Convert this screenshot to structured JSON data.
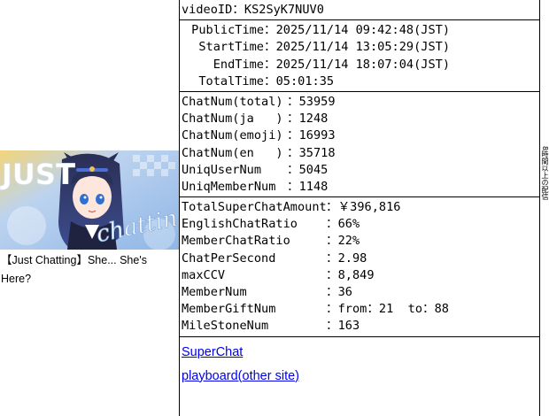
{
  "video_id": {
    "label": "videoID",
    "value": "KS2SyK7NUV0"
  },
  "times": [
    {
      "label": "PublicTime",
      "value": "2025/11/14 09:42:48(JST)"
    },
    {
      "label": "StartTime",
      "value": "2025/11/14 13:05:29(JST)"
    },
    {
      "label": "EndTime",
      "value": "2025/11/14 18:07:04(JST)"
    },
    {
      "label": "TotalTime",
      "value": "05:01:35"
    }
  ],
  "chat_counts": [
    {
      "label": "ChatNum(total)",
      "value": "53959"
    },
    {
      "label": "ChatNum(ja   )",
      "value": "1248"
    },
    {
      "label": "ChatNum(emoji)",
      "value": "16993"
    },
    {
      "label": "ChatNum(en   )",
      "value": "35718"
    },
    {
      "label": "UniqUserNum   ",
      "value": "5045"
    },
    {
      "label": "UniqMemberNum ",
      "value": "1148"
    }
  ],
  "stats": [
    {
      "label": "TotalSuperChatAmount",
      "value": "￥396,816"
    },
    {
      "label": "EnglishChatRatio",
      "value": "66%"
    },
    {
      "label": "MemberChatRatio",
      "value": "22%"
    },
    {
      "label": "ChatPerSecond",
      "value": "2.98"
    },
    {
      "label": "maxCCV",
      "value": "8,849"
    },
    {
      "label": "MemberNum",
      "value": "36"
    },
    {
      "label": "MemberGiftNum",
      "value": "from：21  to：88"
    },
    {
      "label": "MileStoneNum",
      "value": "163"
    }
  ],
  "separator": "：",
  "links": {
    "superchat": "SuperChat",
    "playboard": "playboard(other site)"
  },
  "thumbnail": {
    "title": "【Just Chatting】She... She's Here?",
    "overlay_text_top": "JUST",
    "overlay_text_bottom": "chatting"
  },
  "side_text": "8時間以上の配信"
}
